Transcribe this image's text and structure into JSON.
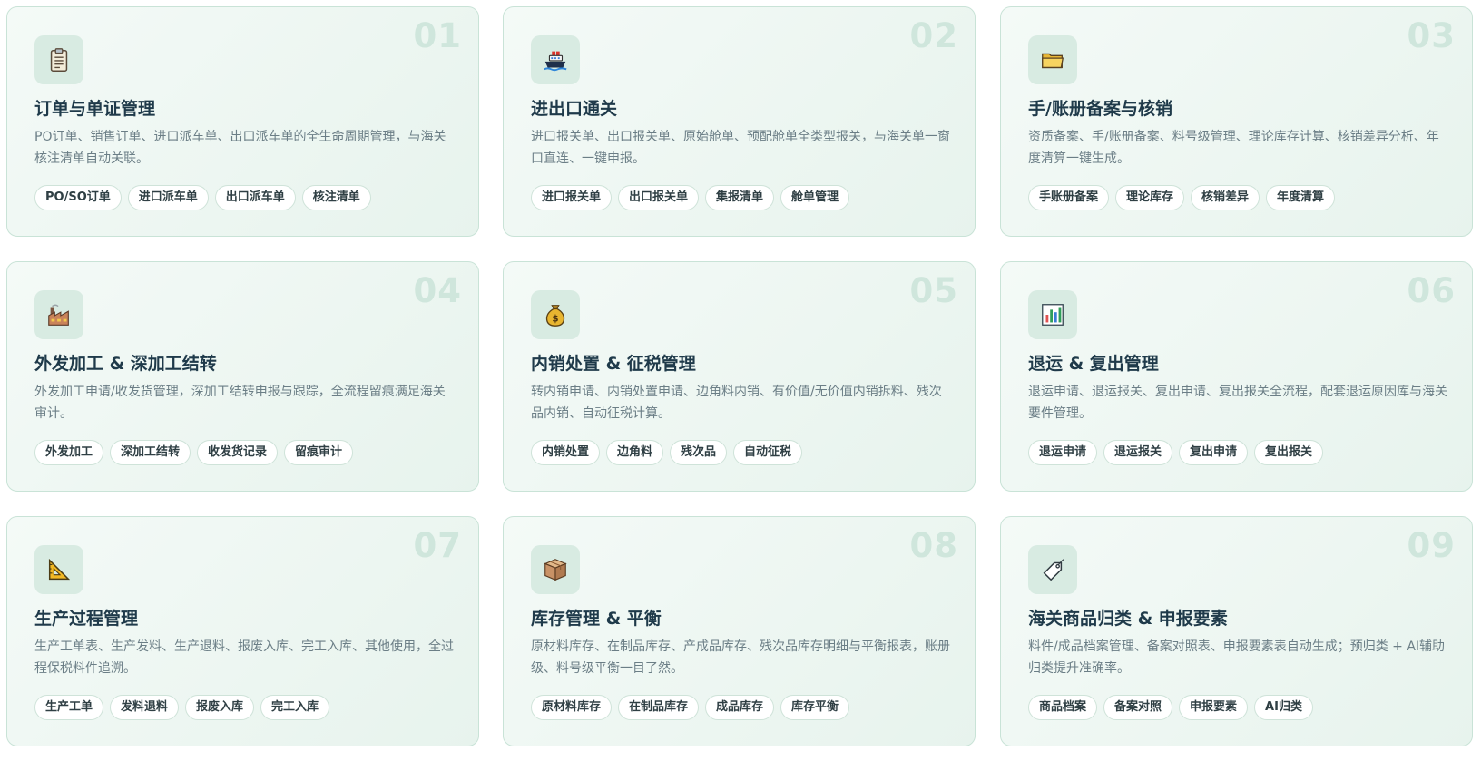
{
  "features": [
    {
      "number": "01",
      "icon": "clipboard-icon",
      "title": "订单与单证管理",
      "description": "PO订单、销售订单、进口派车单、出口派车单的全生命周期管理，与海关核注清单自动关联。",
      "tags": [
        "PO/SO订单",
        "进口派车单",
        "出口派车单",
        "核注清单"
      ]
    },
    {
      "number": "02",
      "icon": "ship-icon",
      "title": "进出口通关",
      "description": "进口报关单、出口报关单、原始舱单、预配舱单全类型报关，与海关单一窗口直连、一键申报。",
      "tags": [
        "进口报关单",
        "出口报关单",
        "集报清单",
        "舱单管理"
      ]
    },
    {
      "number": "03",
      "icon": "folder-icon",
      "title": "手/账册备案与核销",
      "description": "资质备案、手/账册备案、料号级管理、理论库存计算、核销差异分析、年度清算一键生成。",
      "tags": [
        "手账册备案",
        "理论库存",
        "核销差异",
        "年度清算"
      ]
    },
    {
      "number": "04",
      "icon": "factory-icon",
      "title": "外发加工 & 深加工结转",
      "description": "外发加工申请/收发货管理，深加工结转申报与跟踪，全流程留痕满足海关审计。",
      "tags": [
        "外发加工",
        "深加工结转",
        "收发货记录",
        "留痕审计"
      ]
    },
    {
      "number": "05",
      "icon": "money-bag-icon",
      "title": "内销处置 & 征税管理",
      "description": "转内销申请、内销处置申请、边角料内销、有价值/无价值内销拆料、残次品内销、自动征税计算。",
      "tags": [
        "内销处置",
        "边角料",
        "残次品",
        "自动征税"
      ]
    },
    {
      "number": "06",
      "icon": "bar-chart-icon",
      "title": "退运 & 复出管理",
      "description": "退运申请、退运报关、复出申请、复出报关全流程，配套退运原因库与海关要件管理。",
      "tags": [
        "退运申请",
        "退运报关",
        "复出申请",
        "复出报关"
      ]
    },
    {
      "number": "07",
      "icon": "triangle-ruler-icon",
      "title": "生产过程管理",
      "description": "生产工单表、生产发料、生产退料、报废入库、完工入库、其他使用，全过程保税料件追溯。",
      "tags": [
        "生产工单",
        "发料退料",
        "报废入库",
        "完工入库"
      ]
    },
    {
      "number": "08",
      "icon": "package-icon",
      "title": "库存管理 & 平衡",
      "description": "原材料库存、在制品库存、产成品库存、残次品库存明细与平衡报表，账册级、料号级平衡一目了然。",
      "tags": [
        "原材料库存",
        "在制品库存",
        "成品库存",
        "库存平衡"
      ]
    },
    {
      "number": "09",
      "icon": "label-tag-icon",
      "title": "海关商品归类 & 申报要素",
      "description": "料件/成品档案管理、备案对照表、申报要素表自动生成；预归类 + AI辅助归类提升准确率。",
      "tags": [
        "商品档案",
        "备案对照",
        "申报要素",
        "AI归类"
      ]
    }
  ]
}
